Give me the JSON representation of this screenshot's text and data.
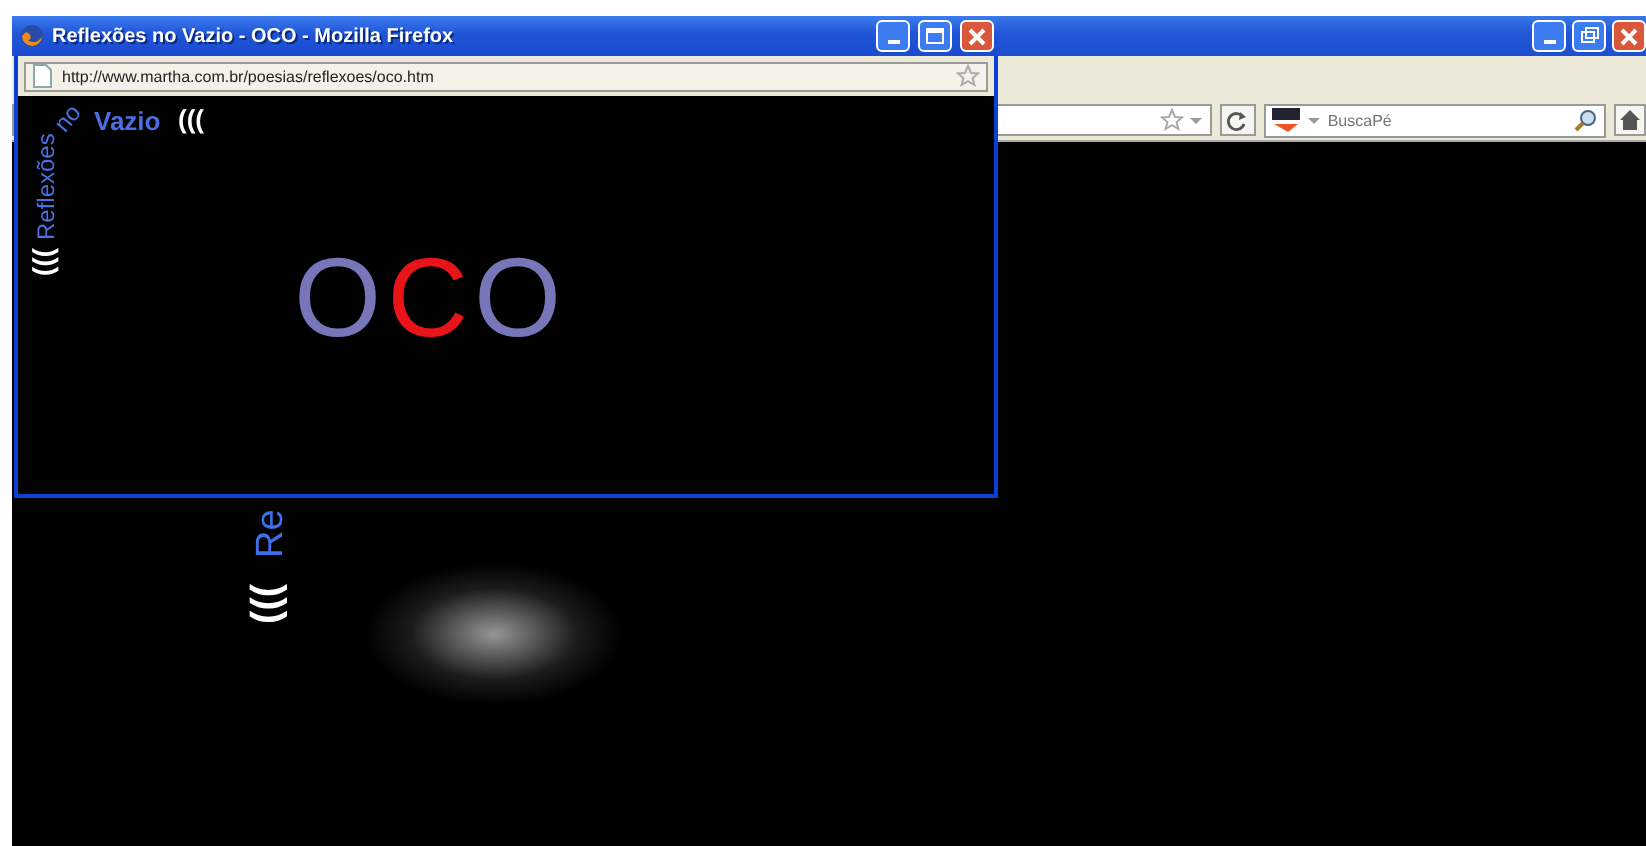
{
  "background_browser": {
    "search": {
      "placeholder": "BuscaPé"
    },
    "content": {
      "title_part": "Re",
      "waves": ")))"
    }
  },
  "popup": {
    "title": "Reflexões no Vazio - OCO - Mozilla Firefox",
    "address": "http://www.martha.com.br/poesias/reflexoes/oco.htm",
    "heading": {
      "word_1": "Reflexões",
      "word_2": "no",
      "word_3": "Vazio",
      "open_waves": "(((",
      "close_waves": ")))"
    },
    "letters": [
      {
        "char": "O",
        "color": "#7676b8"
      },
      {
        "char": "C",
        "color": "#e8141a"
      },
      {
        "char": "O",
        "color": "#7676b8"
      }
    ]
  }
}
